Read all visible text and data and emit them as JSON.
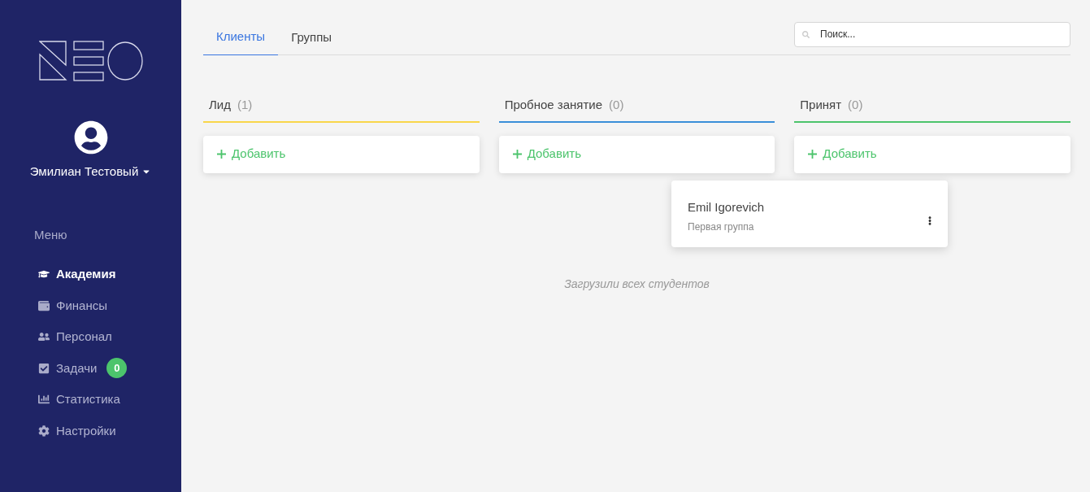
{
  "user": {
    "name": "Эмилиан Тестовый"
  },
  "menu": {
    "title": "Меню",
    "items": [
      {
        "label": "Академия",
        "selected": true
      },
      {
        "label": "Финансы",
        "selected": false
      },
      {
        "label": "Персонал",
        "selected": false
      },
      {
        "label": "Задачи",
        "selected": false,
        "badge": "0"
      },
      {
        "label": "Статистика",
        "selected": false
      },
      {
        "label": "Настройки",
        "selected": false
      }
    ]
  },
  "tabs": [
    {
      "label": "Клиенты",
      "selected": true
    },
    {
      "label": "Группы",
      "selected": false
    }
  ],
  "search": {
    "placeholder": "Поиск..."
  },
  "columns": [
    {
      "title": "Лид",
      "count": "(1)",
      "color": "#f9d64a",
      "add_label": "Добавить"
    },
    {
      "title": "Пробное занятие",
      "count": "(0)",
      "color": "#3a8fd9",
      "add_label": "Добавить"
    },
    {
      "title": "Принят",
      "count": "(0)",
      "color": "#4cc46c",
      "add_label": "Добавить"
    }
  ],
  "dragged_card": {
    "name": "Emil Igorevich",
    "group": "Первая группа"
  },
  "status": "Загрузили всех студентов"
}
